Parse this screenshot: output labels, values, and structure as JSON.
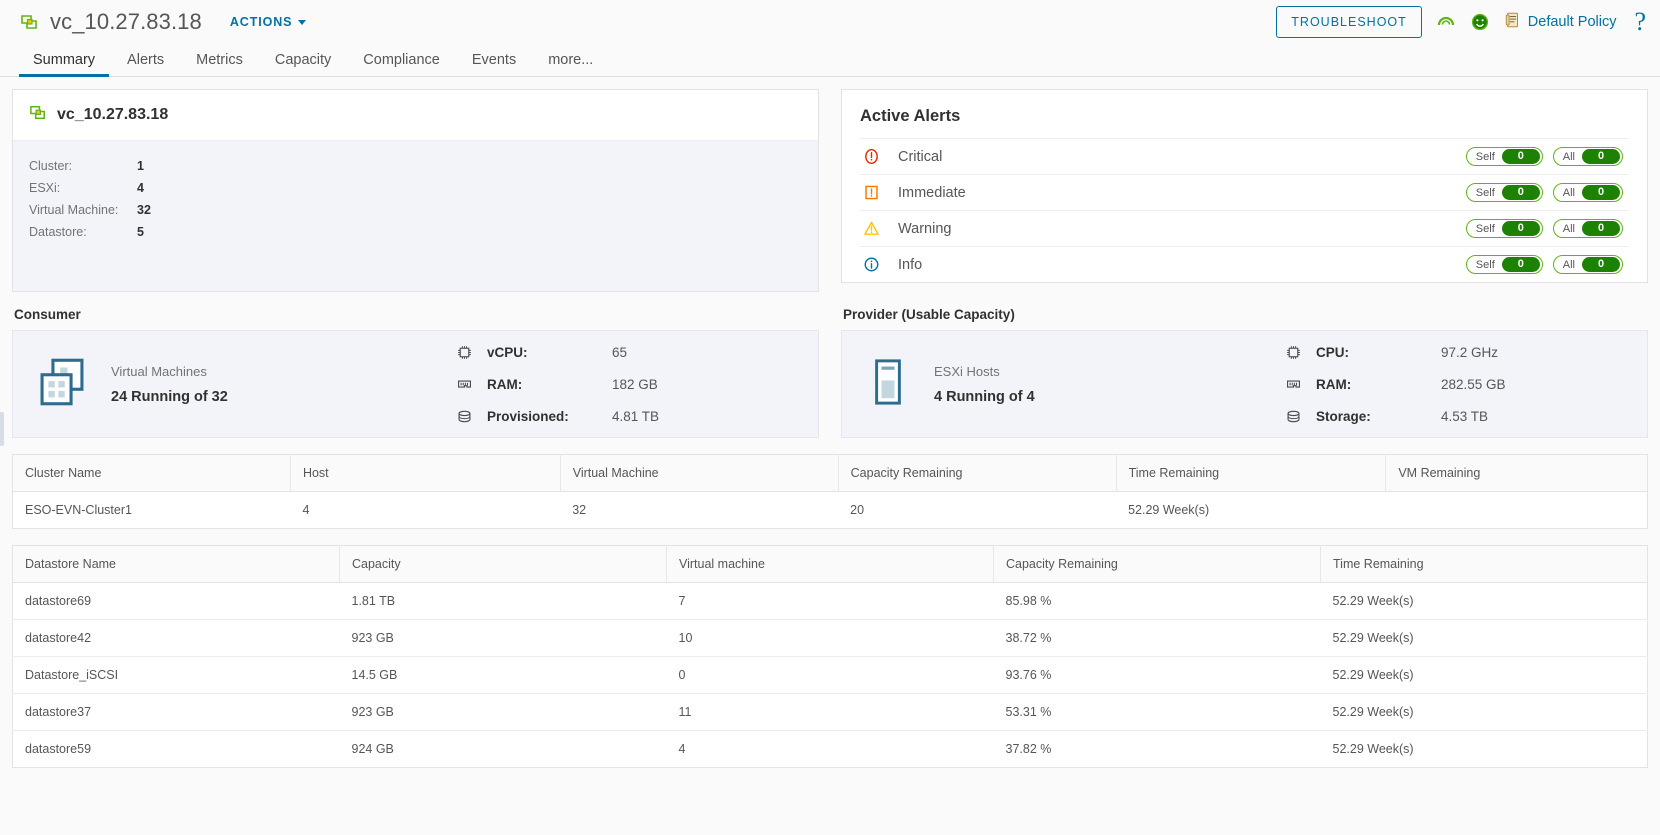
{
  "header": {
    "object_icon": "vcenter-object-icon",
    "title": "vc_10.27.83.18",
    "actions_label": "ACTIONS",
    "troubleshoot_label": "TROUBLESHOOT",
    "health_icon": "health-gauge-icon",
    "status_icon": "green-smiley-status-icon",
    "policy_icon": "policy-document-icon",
    "policy_label": "Default Policy",
    "help_label": "?",
    "accent_color": "#0072a3"
  },
  "tabs": [
    {
      "label": "Summary",
      "active": true
    },
    {
      "label": "Alerts",
      "active": false
    },
    {
      "label": "Metrics",
      "active": false
    },
    {
      "label": "Capacity",
      "active": false
    },
    {
      "label": "Compliance",
      "active": false
    },
    {
      "label": "Events",
      "active": false
    },
    {
      "label": "more...",
      "active": false
    }
  ],
  "object_card": {
    "title": "vc_10.27.83.18",
    "rows": [
      {
        "key": "Cluster:",
        "value": "1"
      },
      {
        "key": "ESXi:",
        "value": "4"
      },
      {
        "key": "Virtual Machine:",
        "value": "32"
      },
      {
        "key": "Datastore:",
        "value": "5"
      }
    ]
  },
  "active_alerts": {
    "title": "Active Alerts",
    "self_label": "Self",
    "all_label": "All",
    "rows": [
      {
        "icon": "critical-icon",
        "label": "Critical",
        "self": "0",
        "all": "0",
        "color": "#e62700"
      },
      {
        "icon": "immediate-icon",
        "label": "Immediate",
        "self": "0",
        "all": "0",
        "color": "#f57600"
      },
      {
        "icon": "warning-icon",
        "label": "Warning",
        "self": "0",
        "all": "0",
        "color": "#fac400"
      },
      {
        "icon": "info-icon",
        "label": "Info",
        "self": "0",
        "all": "0",
        "color": "#0072a3"
      }
    ]
  },
  "consumer": {
    "section_title": "Consumer",
    "icon": "virtual-machines-icon",
    "entity_label": "Virtual Machines",
    "entity_status": "24 Running of 32",
    "metrics": [
      {
        "icon": "cpu-chip-icon",
        "key": "vCPU:",
        "value": "65"
      },
      {
        "icon": "ram-module-icon",
        "key": "RAM:",
        "value": "182 GB"
      },
      {
        "icon": "storage-disk-icon",
        "key": "Provisioned:",
        "value": "4.81 TB"
      }
    ]
  },
  "provider": {
    "section_title": "Provider (Usable Capacity)",
    "icon": "esxi-host-icon",
    "entity_label": "ESXi Hosts",
    "entity_status": "4 Running of 4",
    "metrics": [
      {
        "icon": "cpu-chip-icon",
        "key": "CPU:",
        "value": "97.2 GHz"
      },
      {
        "icon": "ram-module-icon",
        "key": "RAM:",
        "value": "282.55 GB"
      },
      {
        "icon": "storage-disk-icon",
        "key": "Storage:",
        "value": "4.53 TB"
      }
    ]
  },
  "cluster_table": {
    "columns": [
      "Cluster Name",
      "Host",
      "Virtual Machine",
      "Capacity Remaining",
      "Time Remaining",
      "VM Remaining"
    ],
    "rows": [
      {
        "name": "ESO-EVN-Cluster1",
        "host": "4",
        "vm": "32",
        "capacity_remaining": "20",
        "time_remaining": "52.29 Week(s)",
        "vm_remaining": ""
      }
    ]
  },
  "datastore_table": {
    "columns": [
      "Datastore Name",
      "Capacity",
      "Virtual machine",
      "Capacity Remaining",
      "Time Remaining"
    ],
    "rows": [
      {
        "name": "datastore69",
        "capacity": "1.81 TB",
        "vm": "7",
        "capacity_remaining": "85.98 %",
        "time_remaining": "52.29 Week(s)"
      },
      {
        "name": "datastore42",
        "capacity": "923 GB",
        "vm": "10",
        "capacity_remaining": "38.72 %",
        "time_remaining": "52.29 Week(s)"
      },
      {
        "name": "Datastore_iSCSI",
        "capacity": "14.5 GB",
        "vm": "0",
        "capacity_remaining": "93.76 %",
        "time_remaining": "52.29 Week(s)"
      },
      {
        "name": "datastore37",
        "capacity": "923 GB",
        "vm": "11",
        "capacity_remaining": "53.31 %",
        "time_remaining": "52.29 Week(s)"
      },
      {
        "name": "datastore59",
        "capacity": "924 GB",
        "vm": "4",
        "capacity_remaining": "37.82 %",
        "time_remaining": "52.29 Week(s)"
      }
    ]
  }
}
